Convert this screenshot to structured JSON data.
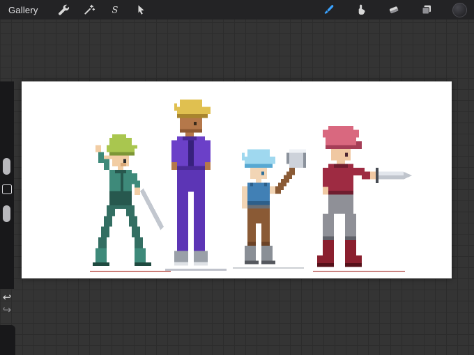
{
  "topbar": {
    "gallery_label": "Gallery",
    "selection_glyph": "S",
    "accent_color": "#3aa2ff",
    "background": "#232325",
    "left_tools": [
      {
        "label": "Actions",
        "icon": "wrench-icon"
      },
      {
        "label": "Adjustments",
        "icon": "magic-wand-icon"
      },
      {
        "label": "Selection",
        "icon": "selection-s-icon"
      },
      {
        "label": "Transform",
        "icon": "transform-arrow-icon"
      }
    ],
    "right_tools": [
      {
        "label": "Paint",
        "icon": "paintbrush-icon",
        "selected": true
      },
      {
        "label": "Smudge",
        "icon": "smudge-finger-icon",
        "selected": false
      },
      {
        "label": "Erase",
        "icon": "eraser-icon",
        "selected": false
      },
      {
        "label": "Layers",
        "icon": "layers-icon",
        "selected": false
      },
      {
        "label": "Color",
        "icon": "color-swatch",
        "selected": false,
        "current_color": "#2b2b2f"
      }
    ]
  },
  "sidebar": {
    "sliders": [
      {
        "name": "brush-size-slider"
      },
      {
        "name": "opacity-slider"
      }
    ],
    "modify_button": true,
    "undo_icon": "↩",
    "redo_icon": "↪"
  },
  "workspace": {
    "background": "#343434",
    "grid_color": "#2c2c2c",
    "grid_size_px": 16
  },
  "canvas": {
    "background": "#ffffff",
    "artwork": "pixel-art character lineup, four figures",
    "characters": [
      {
        "name": "elf-swordsman",
        "hair": "#a9c64f",
        "outfit": "#3e8a7a",
        "weapon": "thin sword",
        "pose": "action stance, arm raised"
      },
      {
        "name": "tall-blonde-tracksuit",
        "hair": "#e0c050",
        "skin": "#b5784a",
        "outfit": "#6b40c8",
        "pose": "standing, hands on hips"
      },
      {
        "name": "blue-haired-axe-wielder",
        "hair": "#9fd8ef",
        "outfit": "#4180b5",
        "pants": "#8a5a35",
        "weapon": "axe raised"
      },
      {
        "name": "pink-haired-swordsman",
        "hair": "#d9687f",
        "outfit": "#9e2b42",
        "boots": "#8a1f2e",
        "weapon": "sword held out"
      }
    ]
  }
}
